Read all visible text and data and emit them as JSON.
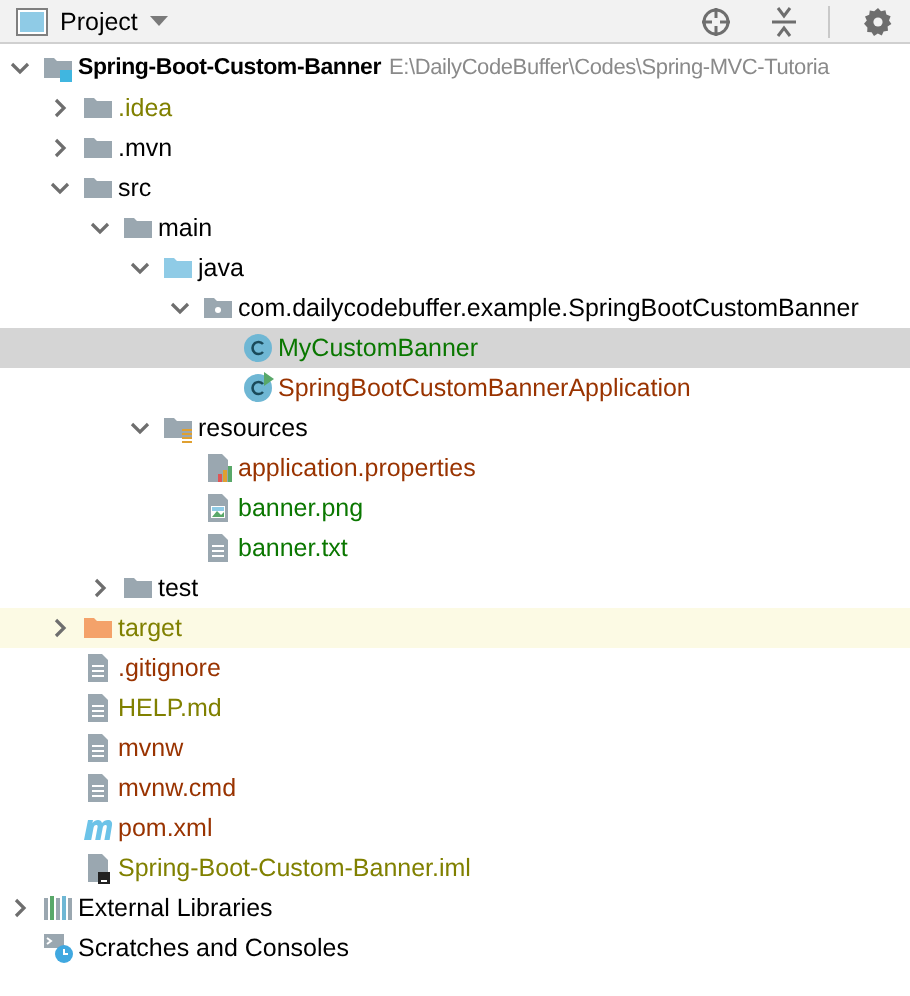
{
  "header": {
    "title": "Project"
  },
  "tree": [
    {
      "label": "Spring-Boot-Custom-Banner",
      "path": "E:\\DailyCodeBuffer\\Codes\\Spring-MVC-Tutoria",
      "kind": "module",
      "color": "#000000",
      "selected": false,
      "ignored": false,
      "expanded": true,
      "children": [
        {
          "label": ".idea",
          "kind": "folder",
          "color": "#808000",
          "selected": false,
          "ignored": false,
          "expanded": false
        },
        {
          "label": ".mvn",
          "kind": "folder",
          "color": "#000000",
          "selected": false,
          "ignored": false,
          "expanded": false
        },
        {
          "label": "src",
          "kind": "folder",
          "color": "#000000",
          "selected": false,
          "ignored": false,
          "expanded": true,
          "children": [
            {
              "label": "main",
              "kind": "folder",
              "color": "#000000",
              "selected": false,
              "ignored": false,
              "expanded": true,
              "children": [
                {
                  "label": "java",
                  "kind": "source-folder",
                  "color": "#000000",
                  "selected": false,
                  "ignored": false,
                  "expanded": true,
                  "children": [
                    {
                      "label": "com.dailycodebuffer.example.SpringBootCustomBanner",
                      "kind": "package",
                      "color": "#000000",
                      "selected": false,
                      "ignored": false,
                      "expanded": true,
                      "children": [
                        {
                          "label": "MyCustomBanner",
                          "kind": "class",
                          "color": "#0a7700",
                          "selected": true,
                          "ignored": false
                        },
                        {
                          "label": "SpringBootCustomBannerApplication",
                          "kind": "app-class",
                          "color": "#993300",
                          "selected": false,
                          "ignored": false
                        }
                      ]
                    }
                  ]
                },
                {
                  "label": "resources",
                  "kind": "resources-folder",
                  "color": "#000000",
                  "selected": false,
                  "ignored": false,
                  "expanded": true,
                  "children": [
                    {
                      "label": "application.properties",
                      "kind": "properties",
                      "color": "#993300",
                      "selected": false,
                      "ignored": false
                    },
                    {
                      "label": "banner.png",
                      "kind": "image",
                      "color": "#0a7700",
                      "selected": false,
                      "ignored": false
                    },
                    {
                      "label": "banner.txt",
                      "kind": "text",
                      "color": "#0a7700",
                      "selected": false,
                      "ignored": false
                    }
                  ]
                }
              ]
            },
            {
              "label": "test",
              "kind": "folder",
              "color": "#000000",
              "selected": false,
              "ignored": false,
              "expanded": false
            }
          ]
        },
        {
          "label": "target",
          "kind": "excluded-folder",
          "color": "#808000",
          "selected": false,
          "ignored": true,
          "expanded": false
        },
        {
          "label": ".gitignore",
          "kind": "text",
          "color": "#993300",
          "selected": false,
          "ignored": false
        },
        {
          "label": "HELP.md",
          "kind": "text",
          "color": "#808000",
          "selected": false,
          "ignored": false
        },
        {
          "label": "mvnw",
          "kind": "text",
          "color": "#993300",
          "selected": false,
          "ignored": false
        },
        {
          "label": "mvnw.cmd",
          "kind": "text",
          "color": "#993300",
          "selected": false,
          "ignored": false
        },
        {
          "label": "pom.xml",
          "kind": "maven",
          "color": "#993300",
          "selected": false,
          "ignored": false
        },
        {
          "label": "Spring-Boot-Custom-Banner.iml",
          "kind": "iml",
          "color": "#808000",
          "selected": false,
          "ignored": false
        }
      ]
    },
    {
      "label": "External Libraries",
      "kind": "libraries",
      "color": "#000000",
      "selected": false,
      "ignored": false,
      "expanded": false
    },
    {
      "label": "Scratches and Consoles",
      "kind": "scratches",
      "color": "#000000",
      "selected": false,
      "ignored": false
    }
  ]
}
